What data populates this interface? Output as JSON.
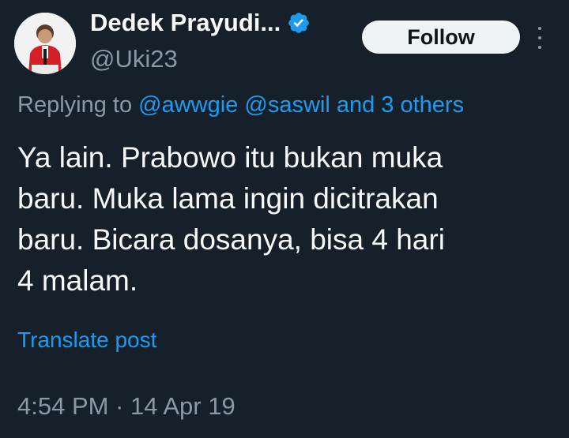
{
  "author": {
    "display_name": "Dedek Prayudi...",
    "handle": "@Uki23",
    "verified": true
  },
  "follow_button_label": "Follow",
  "reply": {
    "prefix": "Replying to",
    "mention_1": "@awwgie",
    "mention_2": "@saswil",
    "and_text": "and",
    "others_text": "3 others"
  },
  "tweet": {
    "lines": [
      "Ya lain. Prabowo itu bukan muka",
      "baru. Muka lama ingin dicitrakan",
      "baru. Bicara dosanya, bisa 4 hari",
      "4 malam."
    ]
  },
  "translate_label": "Translate post",
  "timestamp": "4:54 PM · 14 Apr 19",
  "colors": {
    "background": "#15202b",
    "text_primary": "#f7f9f9",
    "text_secondary": "#8b98a5",
    "accent": "#1d9bf0",
    "follow_bg": "#eff3f4"
  },
  "icons": {
    "verified": "verified-badge-icon",
    "more": "more-options-icon"
  }
}
